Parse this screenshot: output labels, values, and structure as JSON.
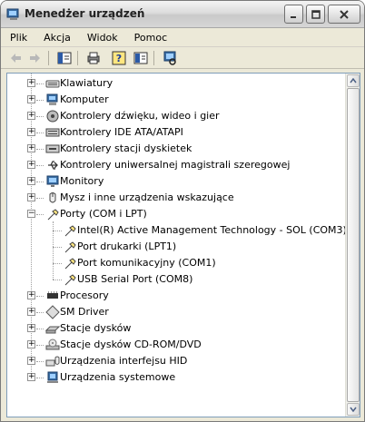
{
  "window": {
    "title": "Menedżer urządzeń"
  },
  "menu": [
    "Plik",
    "Akcja",
    "Widok",
    "Pomoc"
  ],
  "toolbar": {
    "back": "back-icon",
    "forward": "forward-icon",
    "show_hide_tree": "console-tree-icon",
    "print": "printer-icon",
    "help": "help-icon",
    "properties": "properties-icon",
    "scan": "scan-hardware-icon"
  },
  "tree": {
    "categories": [
      "Klawiatury",
      "Komputer",
      "Kontrolery dźwięku, wideo i gier",
      "Kontrolery IDE ATA/ATAPI",
      "Kontrolery stacji dyskietek",
      "Kontrolery uniwersalnej magistrali szeregowej",
      "Monitory",
      "Mysz i inne urządzenia wskazujące",
      "Porty (COM i LPT)",
      "Procesory",
      "SM Driver",
      "Stacje dysków",
      "Stacje dysków CD-ROM/DVD",
      "Urządzenia interfejsu HID",
      "Urządzenia systemowe"
    ],
    "ports": [
      "Intel(R) Active Management Technology - SOL (COM3)",
      "Port drukarki (LPT1)",
      "Port komunikacyjny (COM1)",
      "USB Serial Port (COM8)"
    ],
    "expanded_symbol": "−",
    "collapsed_symbol": "+"
  },
  "colors": {
    "window_bg": "#ece9d8",
    "border": "#7f9db9"
  }
}
